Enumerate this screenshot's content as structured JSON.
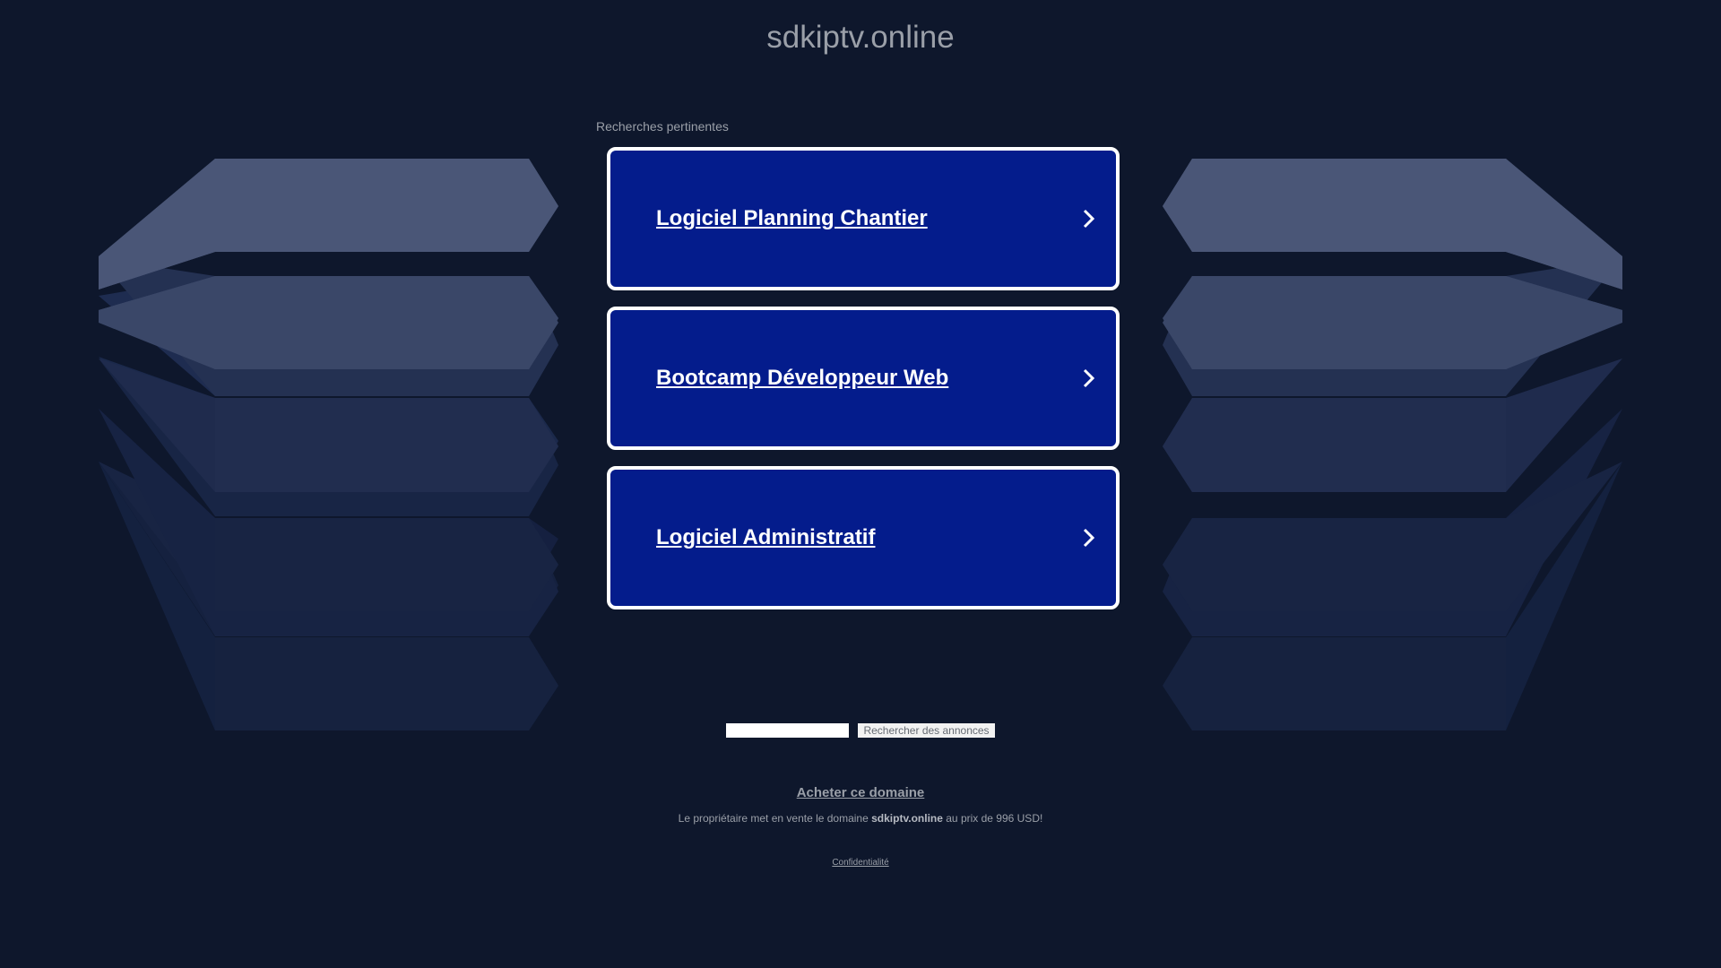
{
  "header": {
    "domain": "sdkiptv.online"
  },
  "related": {
    "label": "Recherches pertinentes",
    "items": [
      {
        "label": "Logiciel Planning Chantier"
      },
      {
        "label": "Bootcamp Développeur Web"
      },
      {
        "label": "Logiciel Administratif"
      }
    ]
  },
  "search": {
    "input_value": "",
    "button_label": "Rechercher des annonces"
  },
  "footer": {
    "buy_label": "Acheter ce domaine",
    "sale_prefix": "Le propriétaire met en vente le domaine ",
    "sale_domain": "sdkiptv.online",
    "sale_suffix": " au prix de 996 USD!",
    "privacy_label": "Confidentialité"
  },
  "colors": {
    "background": "#0e172c",
    "card": "#041c8c",
    "card_border": "#ffffff",
    "muted_text": "#9a9fa8"
  }
}
